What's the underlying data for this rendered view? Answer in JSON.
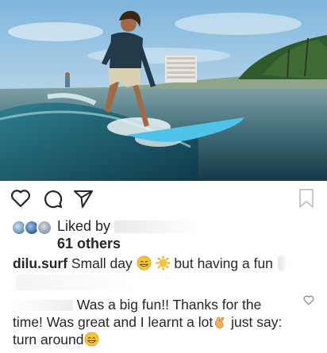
{
  "post": {
    "image_icon": "surfer-photo"
  },
  "actions": {
    "like_icon": "heart-outline-icon",
    "comment_icon": "comment-bubble-icon",
    "share_icon": "paper-plane-icon",
    "save_icon": "bookmark-icon"
  },
  "likes": {
    "liked_by_prefix": "Liked by",
    "others": "61 others"
  },
  "caption": {
    "username": "dilu.surf",
    "text_part1": "Small day",
    "text_part2": "but having a fun"
  },
  "comment": {
    "text_line1": "Was a big fun!! Thanks for the",
    "text_line2": "time! Was great and I learnt a lot",
    "text_line3": "just say:",
    "text_line4": "turn around"
  },
  "colors": {
    "text": "#262626",
    "icon": "#262626",
    "background": "#ffffff"
  }
}
